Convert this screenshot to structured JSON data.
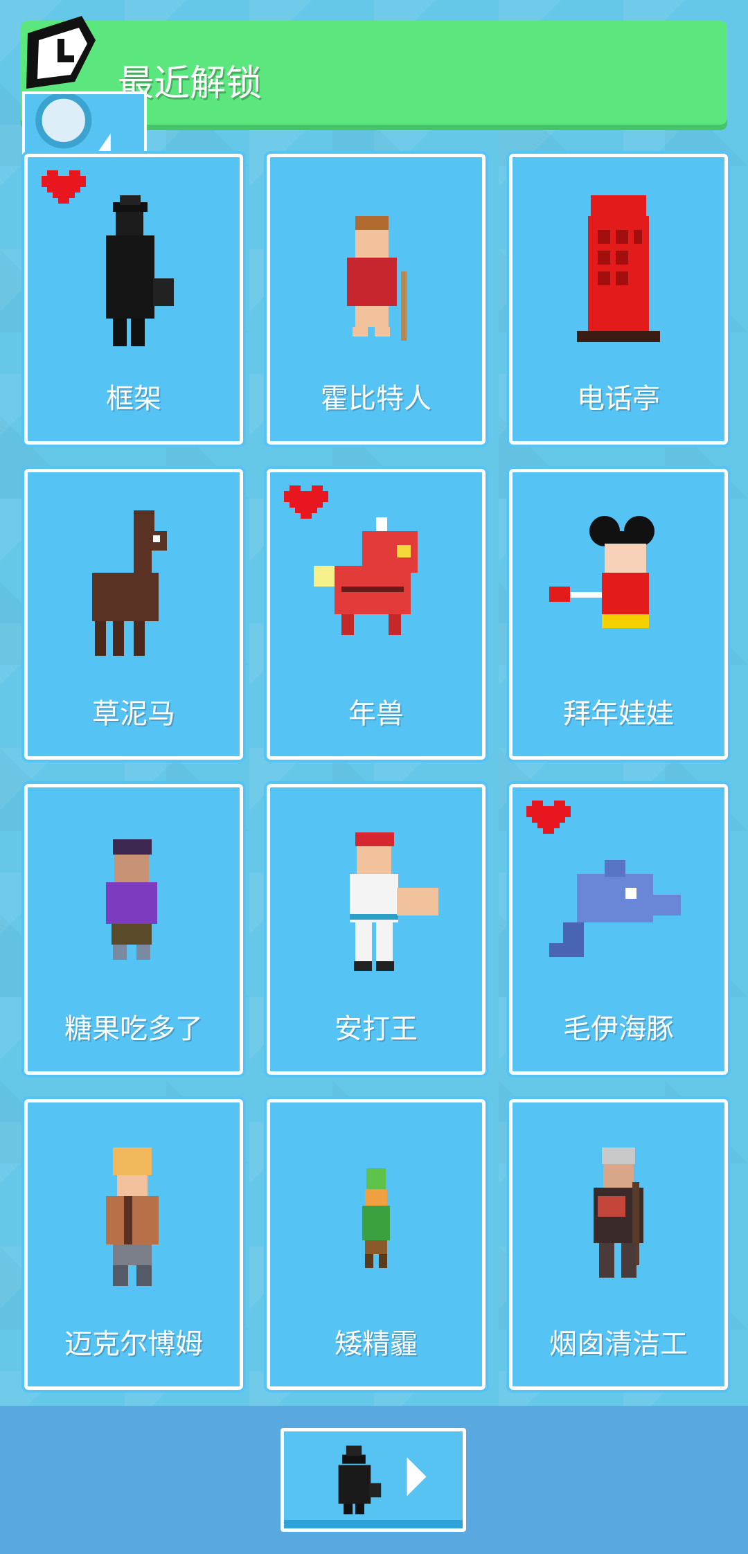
{
  "header": {
    "title": "最近解锁",
    "clock_icon": "clock-icon",
    "back_icon": "back-arrow-icon"
  },
  "colors": {
    "background": "#66c8e8",
    "header": "#5ce67e",
    "card": "#56c3f5",
    "card_border": "#ffffff",
    "heart": "#e8161e",
    "bottom_bar": "#59a9e0"
  },
  "characters": [
    {
      "name": "框架",
      "icon": "black-suit-character-icon",
      "favorite": true
    },
    {
      "name": "霍比特人",
      "icon": "hobbit-character-icon",
      "favorite": false
    },
    {
      "name": "电话亭",
      "icon": "phone-booth-icon",
      "favorite": false
    },
    {
      "name": "草泥马",
      "icon": "llama-icon",
      "favorite": false
    },
    {
      "name": "年兽",
      "icon": "nian-beast-icon",
      "favorite": true
    },
    {
      "name": "拜年娃娃",
      "icon": "new-year-doll-icon",
      "favorite": false
    },
    {
      "name": "糖果吃多了",
      "icon": "candy-kid-icon",
      "favorite": false
    },
    {
      "name": "安打王",
      "icon": "baseball-player-icon",
      "favorite": false
    },
    {
      "name": "毛伊海豚",
      "icon": "dolphin-icon",
      "favorite": true
    },
    {
      "name": "迈克尔博姆",
      "icon": "guitarist-icon",
      "favorite": false
    },
    {
      "name": "矮精霾",
      "icon": "leprechaun-icon",
      "favorite": false
    },
    {
      "name": "烟囱清洁工",
      "icon": "chimney-sweep-icon",
      "favorite": false
    }
  ],
  "play_button": {
    "icon": "play-arrow-icon",
    "preview_icon": "selected-character-icon"
  }
}
